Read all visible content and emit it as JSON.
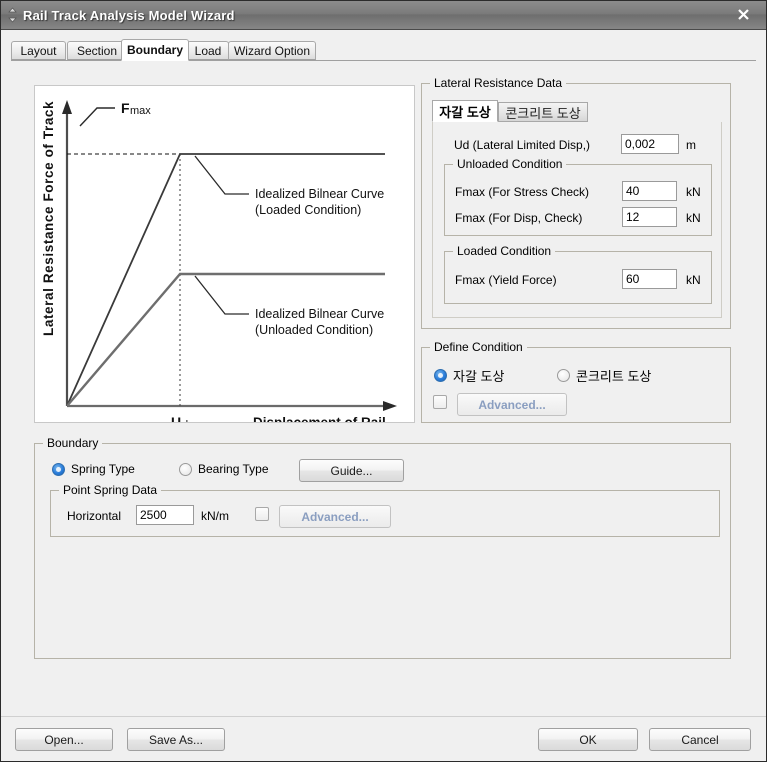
{
  "window": {
    "title": "Rail Track Analysis Model Wizard",
    "icon": "updown-chevron-icon",
    "close_label": "X"
  },
  "tabs": [
    {
      "label": "Layout",
      "active": false
    },
    {
      "label": "Section",
      "active": false
    },
    {
      "label": "Boundary",
      "active": true
    },
    {
      "label": "Load",
      "active": false
    },
    {
      "label": "Wizard Option",
      "active": false
    }
  ],
  "chart_data": {
    "type": "line",
    "title": "",
    "xlabel": "Displacement of Rail",
    "ylabel": "Lateral Resistance Force of Track",
    "xlim": [
      0,
      10
    ],
    "ylim": [
      0,
      10
    ],
    "grid": false,
    "legend_position": "inline-annotation",
    "x_tick_labels": [
      "Ud"
    ],
    "y_annotations": [
      "Fmax"
    ],
    "series": [
      {
        "name": "Idealized Bilnear Curve (Loaded Condition)",
        "x": [
          0,
          2.7,
          10
        ],
        "y": [
          0,
          8.0,
          8.0
        ]
      },
      {
        "name": "Idealized Bilnear Curve (Unloaded Condition)",
        "x": [
          0,
          2.7,
          10
        ],
        "y": [
          0,
          3.6,
          3.6
        ]
      }
    ],
    "annotations": [
      {
        "text": "Fmax",
        "target": "plateau-loaded"
      },
      {
        "text": "Idealized Bilnear Curve",
        "text2": "(Loaded Condition)"
      },
      {
        "text": "Idealized Bilnear Curve",
        "text2": "(Unloaded Condition)"
      }
    ]
  },
  "lateral_resistance": {
    "legend": "Lateral Resistance Data",
    "tabs": [
      {
        "label": "자갈 도상",
        "active": true
      },
      {
        "label": "콘크리트 도상",
        "active": false
      }
    ],
    "ud": {
      "label": "Ud (Lateral Limited Disp,)",
      "value": "0,002",
      "unit": "m"
    },
    "unloaded": {
      "legend": "Unloaded Condition",
      "rows": [
        {
          "label": "Fmax (For Stress Check)",
          "value": "40",
          "unit": "kN"
        },
        {
          "label": "Fmax (For Disp, Check)",
          "value": "12",
          "unit": "kN"
        }
      ]
    },
    "loaded": {
      "legend": "Loaded Condition",
      "rows": [
        {
          "label": "Fmax (Yield Force)",
          "value": "60",
          "unit": "kN"
        }
      ]
    }
  },
  "define_condition": {
    "legend": "Define Condition",
    "options": [
      {
        "label": "자갈 도상",
        "selected": true
      },
      {
        "label": "콘크리트 도상",
        "selected": false
      }
    ],
    "advanced_label": "Advanced..."
  },
  "boundary": {
    "legend": "Boundary",
    "options": [
      {
        "label": "Spring Type",
        "selected": true
      },
      {
        "label": "Bearing Type",
        "selected": false
      }
    ],
    "guide_label": "Guide...",
    "point_spring": {
      "legend": "Point Spring Data",
      "label": "Horizontal",
      "value": "2500",
      "unit": "kN/m",
      "advanced_label": "Advanced..."
    }
  },
  "footer": {
    "open_label": "Open...",
    "save_as_label": "Save As...",
    "ok_label": "OK",
    "cancel_label": "Cancel"
  },
  "colors": {
    "accent": "#2a7ddb",
    "disabled_text": "#8a9ec0",
    "window_bg": "#f0f0f0",
    "group_border": "#b6b3a8"
  }
}
